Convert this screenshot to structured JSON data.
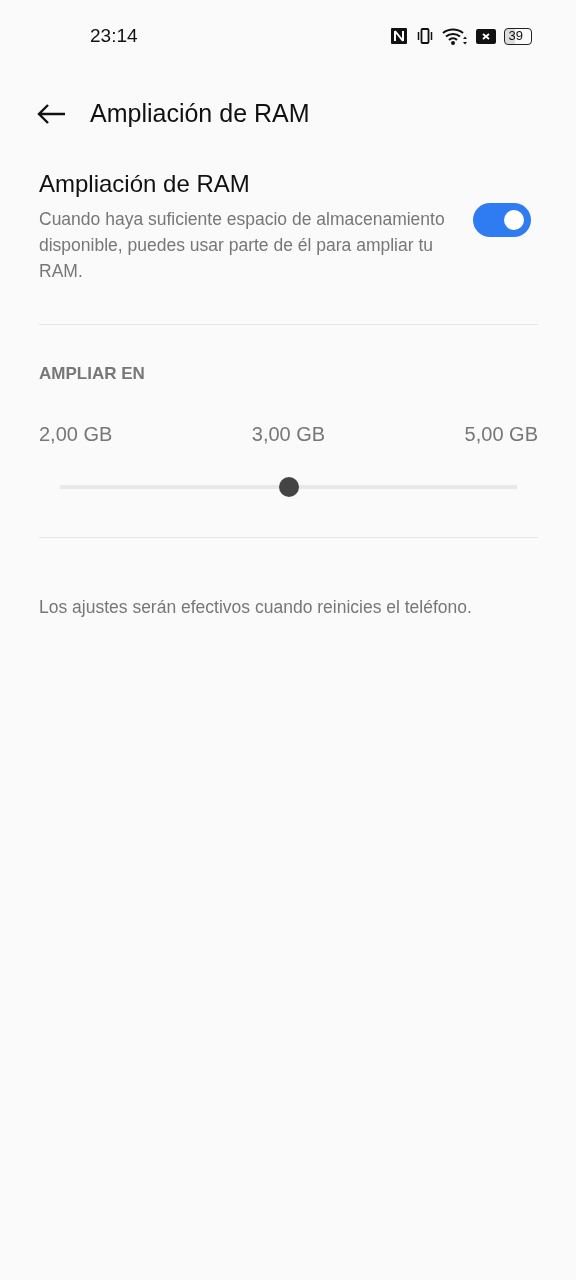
{
  "status_bar": {
    "time": "23:14",
    "battery": "39"
  },
  "header": {
    "title": "Ampliación de RAM"
  },
  "setting": {
    "title": "Ampliación de RAM",
    "description": "Cuando haya suficiente espacio de almacenamiento disponible, puedes usar parte de él para ampliar tu RAM.",
    "on": true
  },
  "section": {
    "heading": "AMPLIAR EN",
    "labels": [
      "2,00 GB",
      "3,00 GB",
      "5,00 GB"
    ],
    "level": 0.5
  },
  "note": "Los ajustes serán efectivos cuando reinicies el teléfono."
}
